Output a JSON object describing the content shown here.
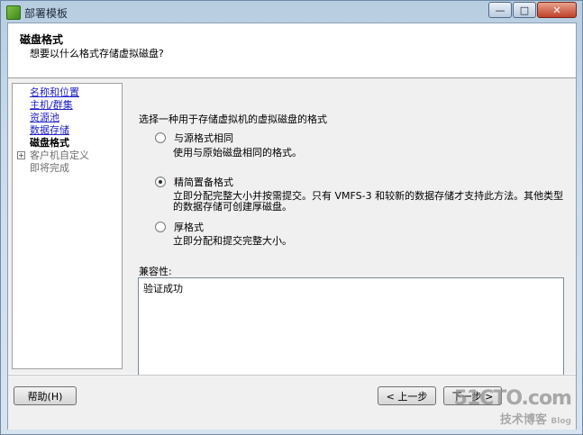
{
  "window": {
    "title": "部署模板",
    "min_label": "—",
    "max_label": "□",
    "close_label": "✕"
  },
  "header": {
    "title": "磁盘格式",
    "subtitle": "想要以什么格式存储虚拟磁盘?"
  },
  "nav": {
    "items": [
      {
        "label": "名称和位置",
        "state": "link"
      },
      {
        "label": "主机/群集",
        "state": "link"
      },
      {
        "label": "资源池",
        "state": "link"
      },
      {
        "label": "数据存储",
        "state": "link"
      },
      {
        "label": "磁盘格式",
        "state": "current"
      },
      {
        "label": "客户机自定义",
        "state": "disabled"
      },
      {
        "label": "即将完成",
        "state": "disabled"
      }
    ]
  },
  "content": {
    "prompt": "选择一种用于存储虚拟机的虚拟磁盘的格式",
    "options": [
      {
        "label": "与源格式相同",
        "description": "使用与原始磁盘相同的格式。",
        "checked": false
      },
      {
        "label": "精简置备格式",
        "description_line1": "立即分配完整大小并按需提交。只有 VMFS-3 和较新的数据存储才支持此方法。其他类型",
        "description_line2": "的数据存储可创建厚磁盘。",
        "checked": true
      },
      {
        "label": "厚格式",
        "description": "立即分配和提交完整大小。",
        "checked": false
      }
    ],
    "compat_label": "兼容性:",
    "compat_value": "验证成功"
  },
  "footer": {
    "help_label": "帮助(H)",
    "back_label": "< 上一步",
    "next_label": "下一步 >"
  },
  "watermark": {
    "line1": "51CTO.com",
    "line2": "技术博客",
    "line3": "Blog"
  }
}
